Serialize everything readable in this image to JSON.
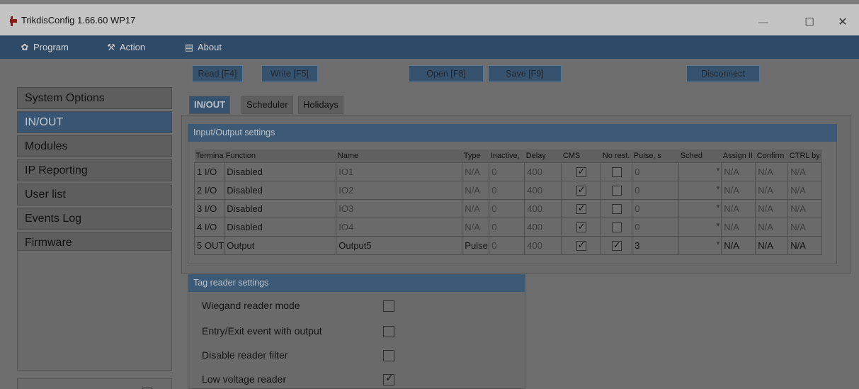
{
  "window": {
    "title": "TrikdisConfig 1.66.60   WP17",
    "minimize": "—",
    "maximize": "☐",
    "close": "✕"
  },
  "menu": {
    "program": "Program",
    "action": "Action",
    "about": "About"
  },
  "toolbar": {
    "read": "Read [F4]",
    "write": "Write [F5]",
    "open": "Open [F8]",
    "save": "Save [F9]",
    "disconnect": "Disconnect"
  },
  "sidebar": {
    "items": [
      {
        "label": "System Options"
      },
      {
        "label": "IN/OUT"
      },
      {
        "label": "Modules"
      },
      {
        "label": "IP Reporting"
      },
      {
        "label": "User list"
      },
      {
        "label": "Events Log"
      },
      {
        "label": "Firmware"
      }
    ],
    "active_index": 1
  },
  "tabs": [
    {
      "label": "IN/OUT"
    },
    {
      "label": "Scheduler"
    },
    {
      "label": "Holidays"
    }
  ],
  "io": {
    "group_title": "Input/Output settings",
    "columns": [
      "Termina",
      "Function",
      "Name",
      "Type",
      "Inactive,",
      "Delay",
      "CMS",
      "No rest.",
      "Pulse, s",
      "Sched",
      "Assign II",
      "Confirm",
      "CTRL by"
    ],
    "rows": [
      {
        "terminal": "1 I/O",
        "function": "Disabled",
        "name": "IO1",
        "type": "N/A",
        "inactive": "0",
        "delay": "400",
        "cms": true,
        "norest": false,
        "pulse": "0",
        "sched": "",
        "assign": "N/A",
        "confirm": "N/A",
        "ctrl": "N/A"
      },
      {
        "terminal": "2 I/O",
        "function": "Disabled",
        "name": "IO2",
        "type": "N/A",
        "inactive": "0",
        "delay": "400",
        "cms": true,
        "norest": false,
        "pulse": "0",
        "sched": "",
        "assign": "N/A",
        "confirm": "N/A",
        "ctrl": "N/A"
      },
      {
        "terminal": "3 I/O",
        "function": "Disabled",
        "name": "IO3",
        "type": "N/A",
        "inactive": "0",
        "delay": "400",
        "cms": true,
        "norest": false,
        "pulse": "0",
        "sched": "",
        "assign": "N/A",
        "confirm": "N/A",
        "ctrl": "N/A"
      },
      {
        "terminal": "4 I/O",
        "function": "Disabled",
        "name": "IO4",
        "type": "N/A",
        "inactive": "0",
        "delay": "400",
        "cms": true,
        "norest": false,
        "pulse": "0",
        "sched": "",
        "assign": "N/A",
        "confirm": "N/A",
        "ctrl": "N/A"
      },
      {
        "terminal": "5 OUT",
        "function": "Output",
        "name": "Output5",
        "type": "Pulse",
        "inactive": "0",
        "delay": "400",
        "cms": true,
        "norest": true,
        "pulse": "3",
        "sched": "",
        "assign": "N/A",
        "confirm": "N/A",
        "ctrl": "N/A"
      }
    ]
  },
  "tag_reader": {
    "group_title": "Tag reader settings",
    "options": [
      {
        "label": "Wiegand reader mode",
        "checked": false
      },
      {
        "label": "Entry/Exit event with output",
        "checked": false
      },
      {
        "label": "Disable reader filter",
        "checked": false
      },
      {
        "label": "Low voltage reader",
        "checked": true
      }
    ]
  }
}
